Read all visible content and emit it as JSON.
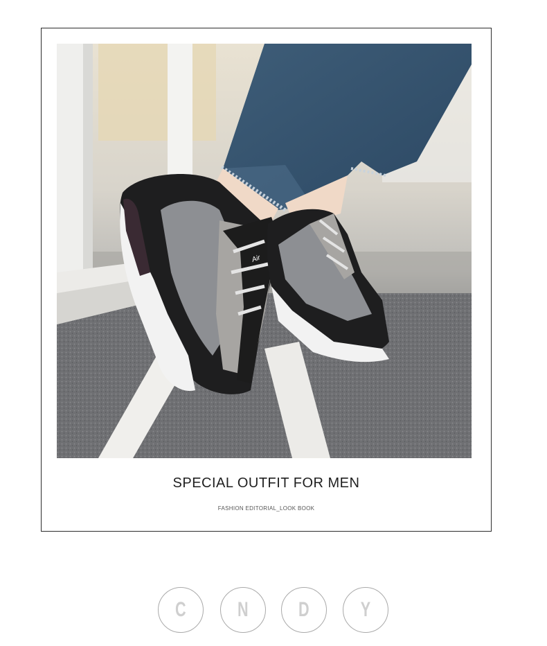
{
  "caption": {
    "title": "SPECIAL OUTFIT FOR MEN",
    "subtitle": "FASHION EDITORIAL_LOOK BOOK"
  },
  "brand_letters": [
    "C",
    "N",
    "D",
    "Y"
  ],
  "colors": {
    "frame_border": "#2b2b2b",
    "title_text": "#1f1f1f",
    "letter_circle": "#a9a9a9",
    "letter_text": "#cfcfcf"
  }
}
